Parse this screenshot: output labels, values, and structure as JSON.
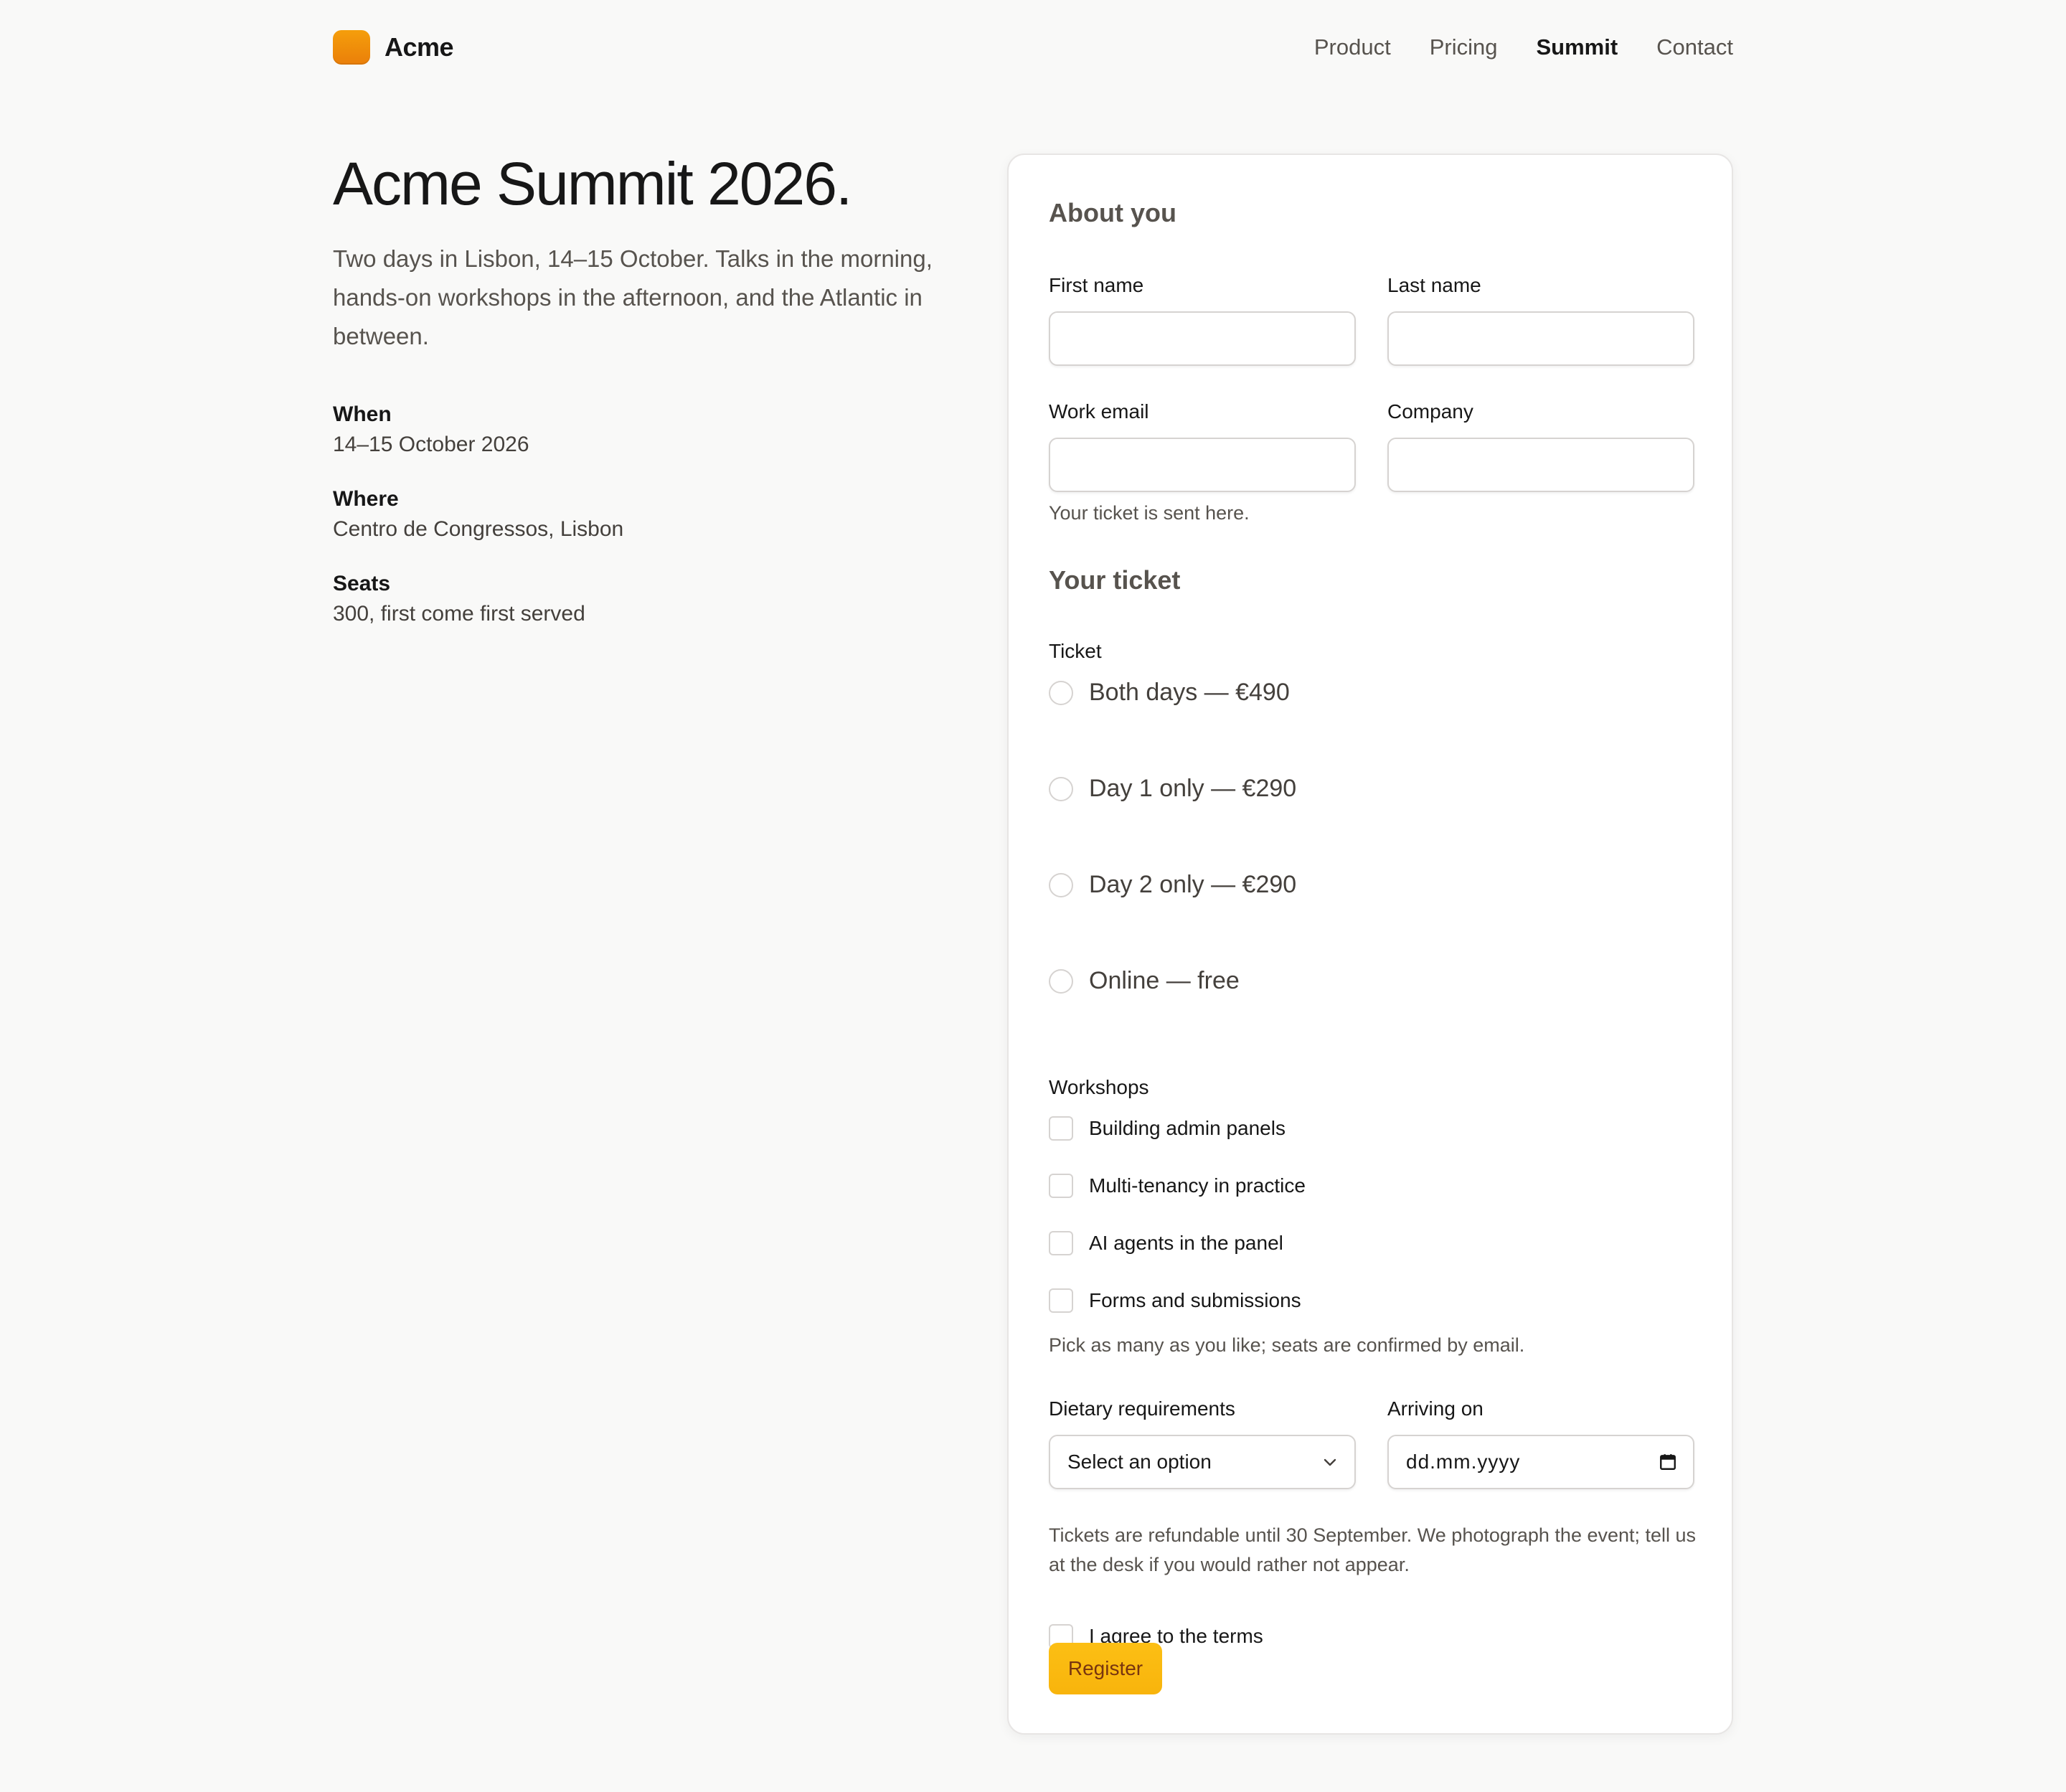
{
  "brand": {
    "name": "Acme",
    "accent": "#f59e0b",
    "button_color": "#fbbf24"
  },
  "nav": {
    "items": [
      {
        "label": "Product",
        "active": false
      },
      {
        "label": "Pricing",
        "active": false
      },
      {
        "label": "Summit",
        "active": true
      },
      {
        "label": "Contact",
        "active": false
      }
    ]
  },
  "intro": {
    "title": "Acme Summit 2026.",
    "lead": "Two days in Lisbon, 14–15 October. Talks in the morning, hands-on workshops in the afternoon, and the Atlantic in between.",
    "facts": [
      {
        "label": "When",
        "value": "14–15 October 2026"
      },
      {
        "label": "Where",
        "value": "Centro de Congressos, Lisbon"
      },
      {
        "label": "Seats",
        "value": "300, first come first served"
      }
    ]
  },
  "form": {
    "about": {
      "title": "About you",
      "first_name": {
        "label": "First name",
        "value": ""
      },
      "last_name": {
        "label": "Last name",
        "value": ""
      },
      "email": {
        "label": "Work email",
        "value": "",
        "hint": "Your ticket is sent here."
      },
      "company": {
        "label": "Company",
        "value": ""
      }
    },
    "ticket": {
      "title": "Your ticket",
      "label": "Ticket",
      "options": [
        {
          "label": "Both days — €490",
          "selected": false
        },
        {
          "label": "Day 1 only — €290",
          "selected": false
        },
        {
          "label": "Day 2 only — €290",
          "selected": false
        },
        {
          "label": "Online — free",
          "selected": false
        }
      ]
    },
    "workshops": {
      "label": "Workshops",
      "options": [
        {
          "label": "Building admin panels",
          "checked": false
        },
        {
          "label": "Multi-tenancy in practice",
          "checked": false
        },
        {
          "label": "AI agents in the panel",
          "checked": false
        },
        {
          "label": "Forms and submissions",
          "checked": false
        }
      ],
      "hint": "Pick as many as you like; seats are confirmed by email."
    },
    "dietary": {
      "label": "Dietary requirements",
      "value": "Select an option"
    },
    "arriving": {
      "label": "Arriving on",
      "value": "dd.mm.yyyy"
    },
    "notice": "Tickets are refundable until 30 September. We photograph the event; tell us at the desk if you would rather not appear.",
    "terms": {
      "label": "I agree to the terms",
      "checked": false
    },
    "submit_label": "Register"
  }
}
